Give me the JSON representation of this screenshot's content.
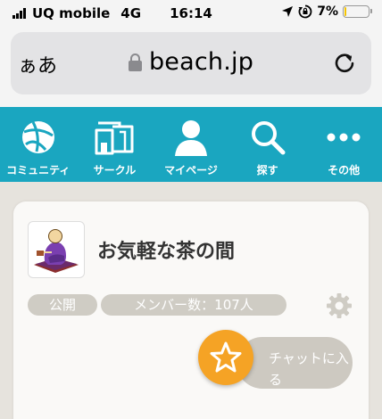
{
  "status_bar": {
    "carrier": "UQ mobile",
    "network": "4G",
    "time": "16:14",
    "battery_percent": "7%",
    "battery_level": 0.07,
    "icons": [
      "signal-icon",
      "location-icon",
      "orientation-lock-icon",
      "battery-icon"
    ]
  },
  "browser": {
    "text_size_label": "ぁあ",
    "host": "beach.jp",
    "icons": [
      "lock-icon",
      "reload-icon"
    ]
  },
  "nav": {
    "items": [
      {
        "label": "コミュニティ",
        "icon": "community-icon"
      },
      {
        "label": "サークル",
        "icon": "circle-icon"
      },
      {
        "label": "マイページ",
        "icon": "user-icon"
      },
      {
        "label": "探す",
        "icon": "search-icon"
      },
      {
        "label": "その他",
        "icon": "more-icon"
      }
    ]
  },
  "circle_card": {
    "title": "お気軽な茶の間",
    "visibility_badge": "公開",
    "members_badge": "メンバー数：107人",
    "chat_button_label": "チャットに入る",
    "icons": [
      "gear-icon",
      "star-icon"
    ]
  },
  "colors": {
    "nav_background": "#1aa6c0",
    "page_background": "#e6e3dd",
    "card_background": "#faf9f7",
    "badge_background": "#cfccc4",
    "chat_star": "#f5a325"
  }
}
